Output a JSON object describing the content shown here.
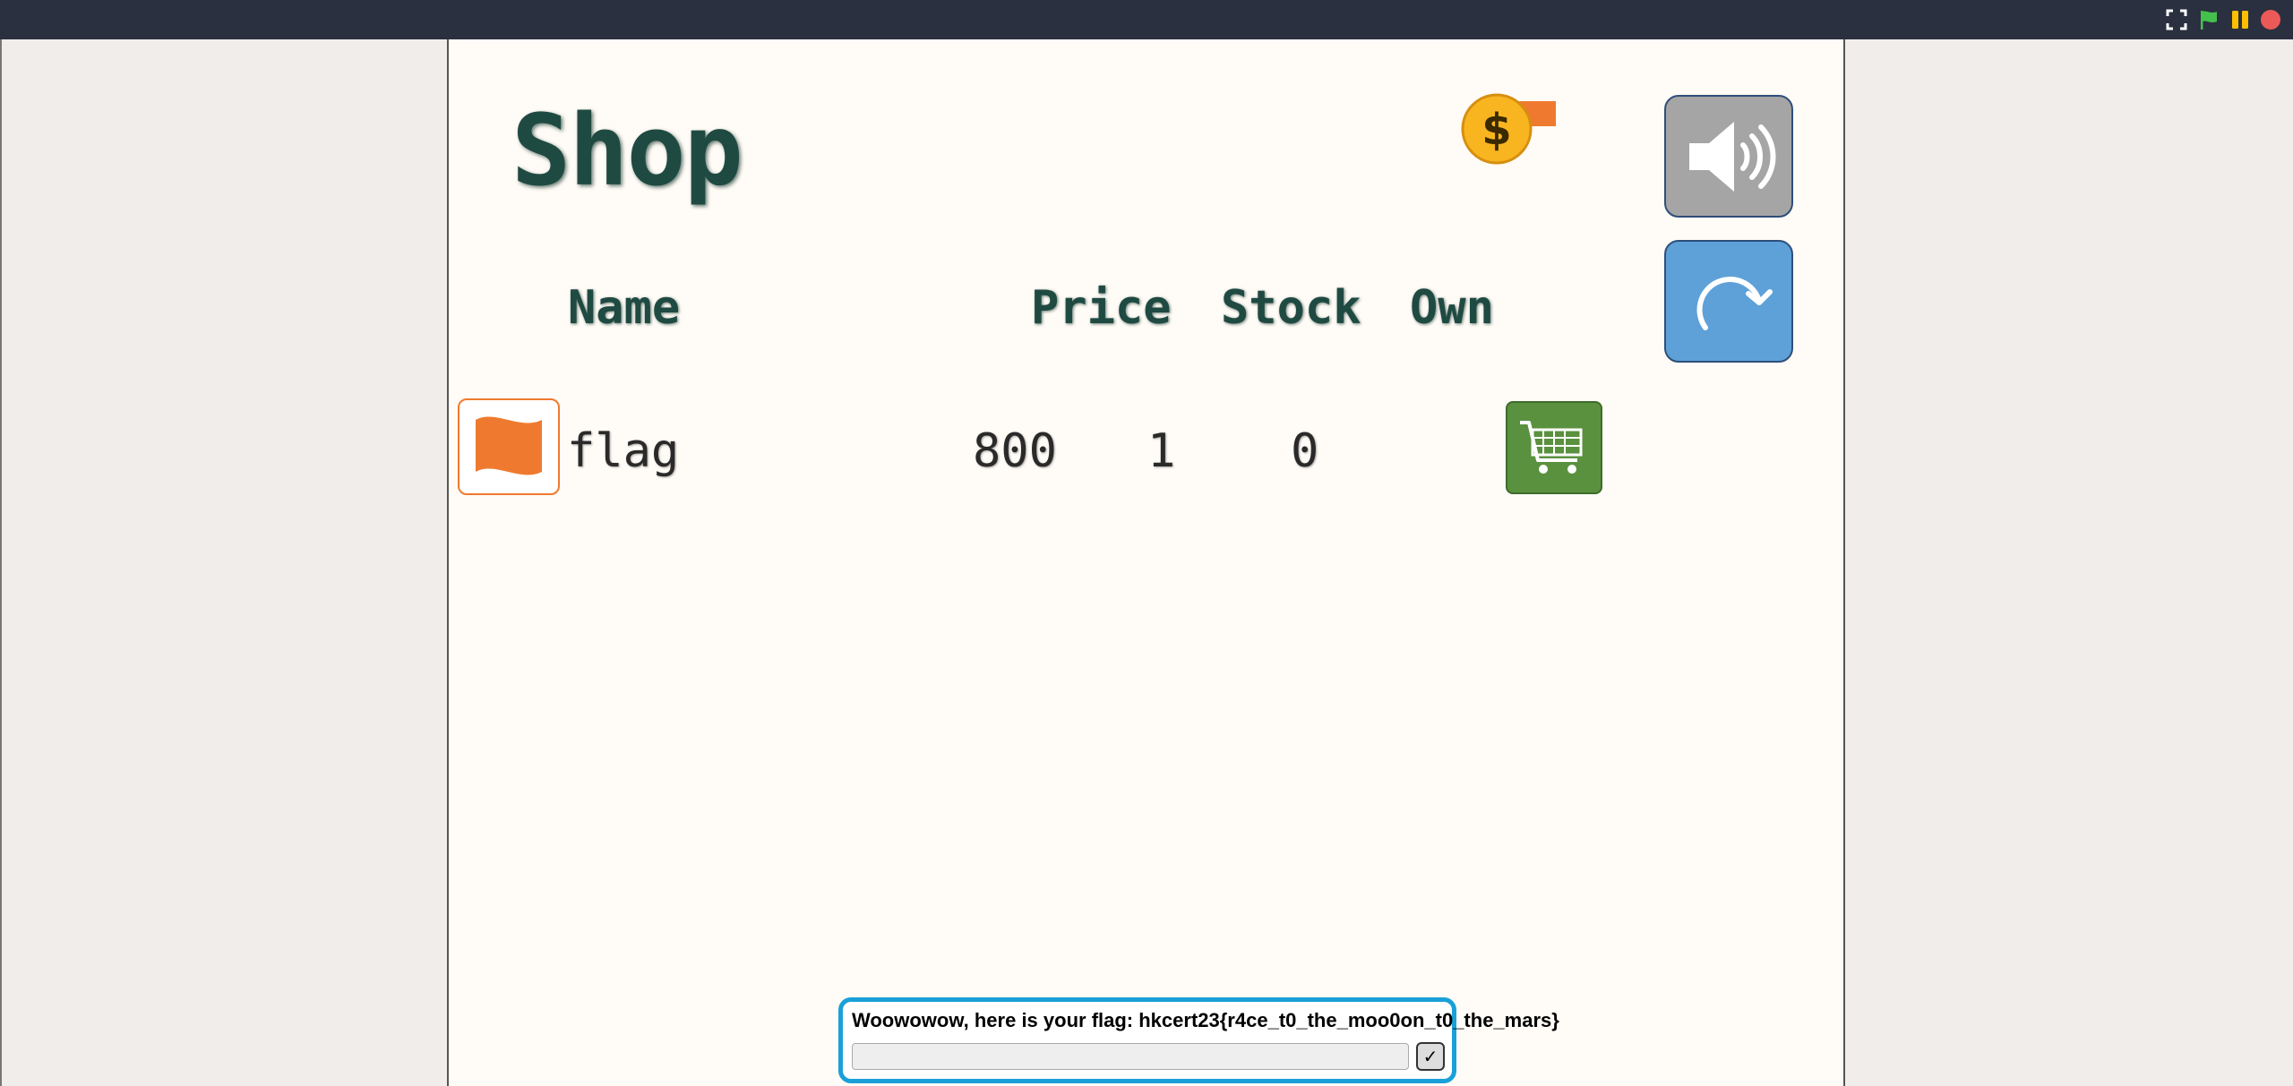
{
  "shop": {
    "title": "Shop",
    "columns": {
      "name": "Name",
      "price": "Price",
      "stock": "Stock",
      "own": "Own"
    },
    "items": [
      {
        "name": "flag",
        "price": "800",
        "stock": "1",
        "own": "0",
        "icon": "flag-icon"
      }
    ]
  },
  "ask": {
    "message": "Woowowow, here is your flag: hkcert23{r4ce_t0_the_moo0on_t0_the_mars}",
    "input_value": "",
    "submit_label": "✓"
  },
  "icons": {
    "fullscreen": "fullscreen-icon",
    "green_flag": "green-flag-icon",
    "pause": "pause-icon",
    "stop": "stop-icon",
    "coin": "coin-icon",
    "sound": "speaker-icon",
    "reset": "reload-icon",
    "cart": "cart-icon"
  },
  "colors": {
    "topbar": "#2a303f",
    "title": "#1f4a42",
    "flag_orange": "#ef7a2f",
    "cart_green": "#5a913e",
    "reset_blue": "#5ea1d8",
    "sound_gray": "#a5a5a5",
    "ask_border": "#1aa0d8"
  }
}
